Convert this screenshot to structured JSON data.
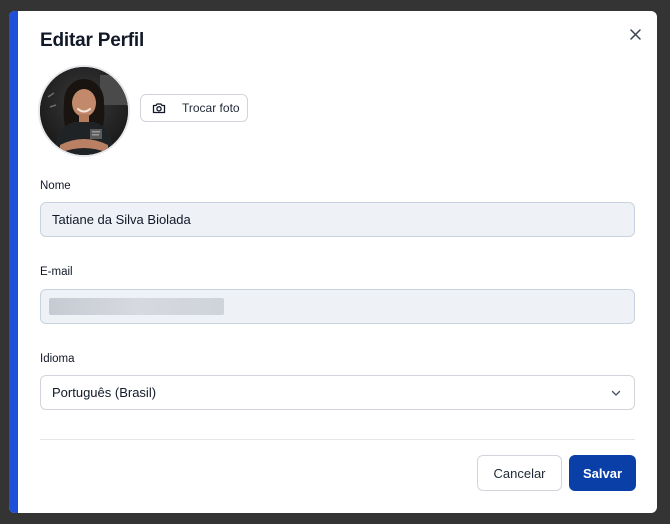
{
  "dialog": {
    "title": "Editar Perfil",
    "accent_color": "#1d4fd8"
  },
  "avatar": {
    "icon": "profile-photo"
  },
  "photo_button": {
    "label": "Trocar foto",
    "icon": "camera-icon"
  },
  "fields": {
    "name": {
      "label": "Nome",
      "value": "Tatiane da Silva Biolada"
    },
    "email": {
      "label": "E-mail",
      "value_redacted": true
    },
    "language": {
      "label": "Idioma",
      "value": "Português (Brasil)"
    }
  },
  "actions": {
    "cancel_label": "Cancelar",
    "save_label": "Salvar",
    "save_color": "#0b3fa8"
  }
}
